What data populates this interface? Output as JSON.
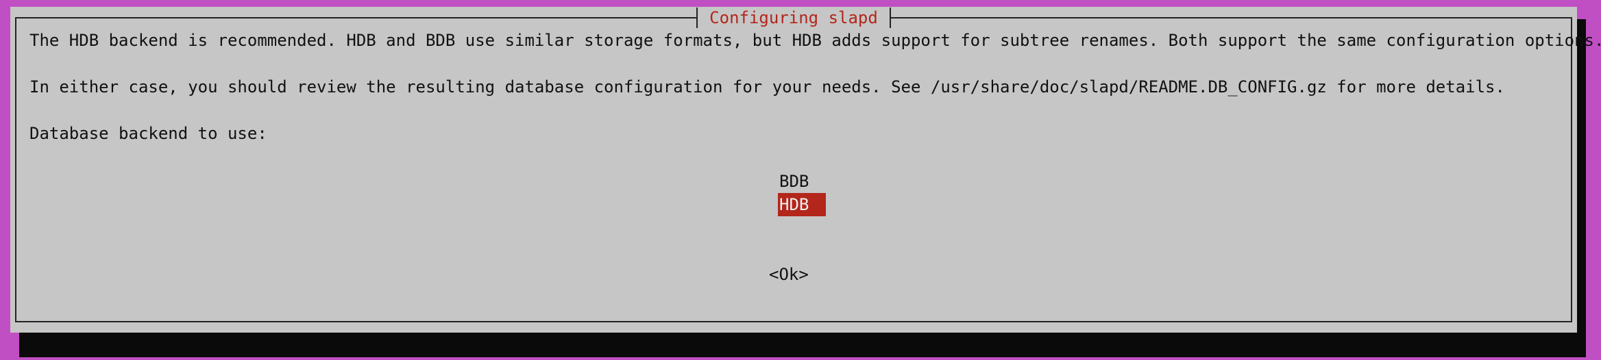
{
  "dialog": {
    "title": "Configuring slapd",
    "lines": [
      "The HDB backend is recommended. HDB and BDB use similar storage formats, but HDB adds support for subtree renames. Both support the same configuration options.",
      "In either case, you should review the resulting database configuration for your needs. See /usr/share/doc/slapd/README.DB_CONFIG.gz for more details.",
      "Database backend to use:"
    ],
    "options": [
      {
        "label": "BDB",
        "selected": false
      },
      {
        "label": "HDB",
        "selected": true
      }
    ],
    "ok_label": "<Ok>"
  },
  "colors": {
    "background": "#c04fc4",
    "dialog": "#c6c6c6",
    "accent": "#b3261b",
    "shadow": "#0a0a0a"
  }
}
